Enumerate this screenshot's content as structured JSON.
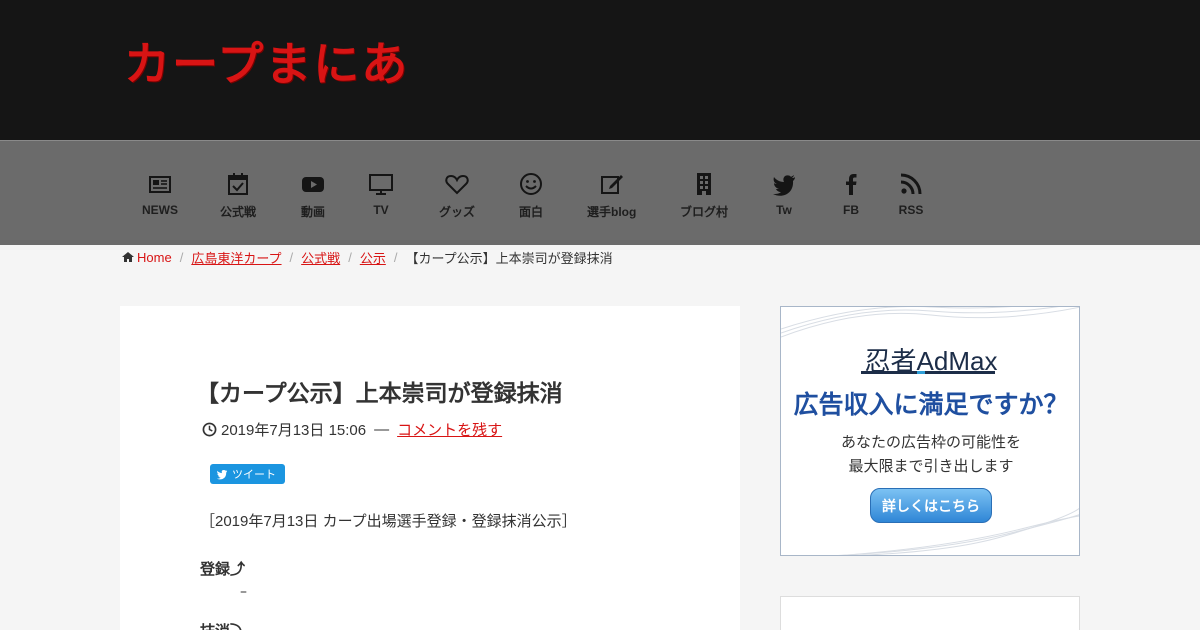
{
  "site": {
    "logo": "カープまにあ"
  },
  "nav": [
    {
      "label": "NEWS",
      "icon": "newspaper-icon"
    },
    {
      "label": "公式戦",
      "icon": "calendar-check-icon"
    },
    {
      "label": "動画",
      "icon": "youtube-icon"
    },
    {
      "label": "TV",
      "icon": "monitor-icon"
    },
    {
      "label": "グッズ",
      "icon": "heart-icon"
    },
    {
      "label": "面白",
      "icon": "smile-icon"
    },
    {
      "label": "選手blog",
      "icon": "edit-icon"
    },
    {
      "label": "ブログ村",
      "icon": "building-icon"
    },
    {
      "label": "Tw",
      "icon": "twitter-icon"
    },
    {
      "label": "FB",
      "icon": "facebook-icon"
    },
    {
      "label": "RSS",
      "icon": "rss-icon"
    }
  ],
  "breadcrumb": {
    "home": "Home",
    "items": [
      "広島東洋カープ",
      "公式戦",
      "公示"
    ],
    "current": "【カープ公示】上本崇司が登録抹消"
  },
  "post": {
    "title": "【カープ公示】上本崇司が登録抹消",
    "date": "2019年7月13日 15:06",
    "dash": "—",
    "comment_link": "コメントを残す",
    "tweet_label": "ツイート",
    "lead": "［2019年7月13日 カープ出場選手登録・登録抹消公示］",
    "registered_heading": "登録⤴",
    "registered_value": "–",
    "removed_heading": "抹消⤵"
  },
  "ad": {
    "brand": "忍者AdMax",
    "headline": "広告収入に満足ですか？",
    "line1": "あなたの広告枠の可能性を",
    "line2": "最大限まで引き出します",
    "button": "詳しくはこちら",
    "colors": {
      "brand": "#1c2d48",
      "headline": "#1f4fa0",
      "button": "#2f86d6"
    }
  },
  "colors": {
    "accent": "#d81414",
    "header_bg": "#151515",
    "nav_bg": "#6b6b6b"
  }
}
